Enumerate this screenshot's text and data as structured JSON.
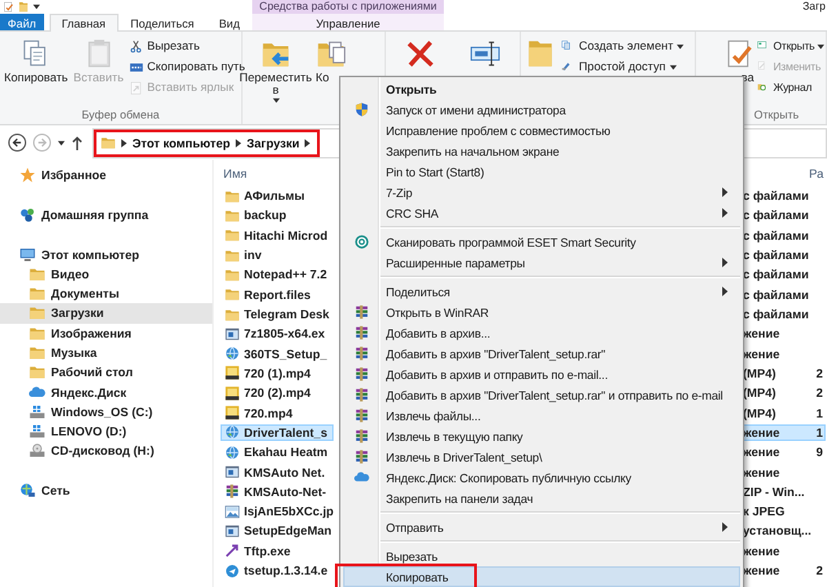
{
  "window": {
    "title": "Загр",
    "context_header": "Средства работы с приложениями"
  },
  "tabs": [
    {
      "label": "Файл",
      "kind": "file",
      "selected": false
    },
    {
      "label": "Главная",
      "kind": "tab",
      "selected": true
    },
    {
      "label": "Поделиться",
      "kind": "tab",
      "selected": false
    },
    {
      "label": "Вид",
      "kind": "tab",
      "selected": false
    },
    {
      "label": "Управление",
      "kind": "context",
      "selected": false
    }
  ],
  "ribbon": {
    "groups": [
      {
        "label": "Буфер обмена",
        "large": [
          {
            "kind": "copy",
            "label": "Копировать",
            "disabled": false,
            "dropdown": false
          },
          {
            "kind": "paste",
            "label": "Вставить",
            "disabled": true,
            "dropdown": false
          }
        ],
        "small": [
          {
            "kind": "cut",
            "label": "Вырезать",
            "disabled": false,
            "dropdown": false
          },
          {
            "kind": "copypath",
            "label": "Скопировать путь",
            "disabled": false,
            "dropdown": false
          },
          {
            "kind": "shortcut",
            "label": "Вставить ярлык",
            "disabled": true,
            "dropdown": false
          }
        ]
      },
      {
        "large": [
          {
            "kind": "move",
            "label": "Переместить в",
            "disabled": false,
            "dropdown": true
          },
          {
            "kind": "copyto",
            "label": "Ко",
            "disabled": false,
            "dropdown": false
          }
        ]
      },
      {
        "large": [
          {
            "kind": "delete",
            "disabled": false,
            "dropdown": false
          },
          {
            "kind": "rename",
            "disabled": false,
            "dropdown": false
          }
        ]
      },
      {
        "large": [
          {
            "kind": "newfolder",
            "disabled": false,
            "dropdown": false
          }
        ],
        "small": [
          {
            "kind": "newitem",
            "label": "Создать элемент",
            "disabled": false,
            "dropdown": true
          },
          {
            "kind": "easyaccess",
            "label": "Простой доступ",
            "disabled": false,
            "dropdown": true
          }
        ]
      },
      {
        "label": "Открыть",
        "large": [
          {
            "kind": "properties",
            "label": "ва",
            "disabled": false,
            "dropdown": false
          }
        ],
        "small": [
          {
            "kind": "open",
            "label": "Открыть",
            "disabled": false,
            "dropdown": true
          },
          {
            "kind": "edit",
            "label": "Изменить",
            "disabled": true,
            "dropdown": false
          },
          {
            "kind": "history",
            "label": "Журнал",
            "disabled": false,
            "dropdown": false
          }
        ]
      }
    ]
  },
  "navigation": {
    "back_enabled": true,
    "forward_enabled": false,
    "breadcrumb": {
      "segments": [
        "Этот компьютер",
        "Загрузки"
      ],
      "annotated": true
    }
  },
  "sidebar": {
    "items": [
      {
        "label": "Избранное",
        "kind": "star",
        "selected": false
      },
      {
        "label": "Домашняя группа",
        "kind": "homegroup",
        "selected": false
      },
      {
        "label": "Этот компьютер",
        "kind": "computer",
        "selected": false,
        "children": [
          {
            "label": "Видео",
            "kind": "folder",
            "selected": false
          },
          {
            "label": "Документы",
            "kind": "folder",
            "selected": false
          },
          {
            "label": "Загрузки",
            "kind": "folder",
            "selected": true
          },
          {
            "label": "Изображения",
            "kind": "folder",
            "selected": false
          },
          {
            "label": "Музыка",
            "kind": "folder",
            "selected": false
          },
          {
            "label": "Рабочий стол",
            "kind": "folder",
            "selected": false
          },
          {
            "label": "Яндекс.Диск",
            "kind": "cloud",
            "selected": false
          },
          {
            "label": "Windows_OS (C:)",
            "kind": "drive",
            "selected": false
          },
          {
            "label": "LENOVO (D:)",
            "kind": "drive",
            "selected": false
          },
          {
            "label": "CD-дисковод (H:)",
            "kind": "disc",
            "selected": false
          }
        ]
      },
      {
        "label": "Сеть",
        "kind": "network",
        "selected": false
      }
    ]
  },
  "files": {
    "columns": [
      "Имя",
      "Ра"
    ],
    "rows": [
      {
        "name": "АФильмы",
        "kind": "folder",
        "type": "с файлами",
        "selected": false
      },
      {
        "name": "backup",
        "kind": "folder",
        "type": "с файлами",
        "selected": false
      },
      {
        "name": "Hitachi Microd",
        "kind": "folder",
        "type": "с файлами",
        "selected": false
      },
      {
        "name": "inv",
        "kind": "folder",
        "type": "с файлами",
        "selected": false
      },
      {
        "name": "Notepad++ 7.2",
        "kind": "folder",
        "type": "с файлами",
        "selected": false
      },
      {
        "name": "Report.files",
        "kind": "folder",
        "type": "с файлами",
        "selected": false
      },
      {
        "name": "Telegram Desk",
        "kind": "folder",
        "type": "с файлами",
        "selected": false
      },
      {
        "name": "7z1805-x64.ex",
        "kind": "app",
        "type": "жение",
        "selected": false
      },
      {
        "name": "360TS_Setup_",
        "kind": "globe",
        "type": "жение",
        "selected": false
      },
      {
        "name": "720 (1).mp4",
        "kind": "video",
        "type": "(MP4)",
        "size": "2",
        "selected": false
      },
      {
        "name": "720 (2).mp4",
        "kind": "video",
        "type": "(MP4)",
        "size": "2",
        "selected": false
      },
      {
        "name": "720.mp4",
        "kind": "video",
        "type": "(MP4)",
        "size": "1",
        "selected": false
      },
      {
        "name": "DriverTalent_s",
        "kind": "globe",
        "type": "жение",
        "size": "1",
        "selected": true
      },
      {
        "name": "Ekahau Heatm",
        "kind": "globe",
        "type": "жение",
        "size": "9",
        "selected": false
      },
      {
        "name": "KMSAuto Net.",
        "kind": "app",
        "type": "жение",
        "selected": false
      },
      {
        "name": "KMSAuto-Net-",
        "kind": "archive",
        "type": "ZIP - Win...",
        "selected": false
      },
      {
        "name": "IsjAnE5bXCc.jp",
        "kind": "image",
        "type": "к JPEG",
        "selected": false
      },
      {
        "name": "SetupEdgeMan",
        "kind": "app",
        "type": "установщ...",
        "selected": false
      },
      {
        "name": "Tftp.exe",
        "kind": "shortcut",
        "type": "жение",
        "selected": false
      },
      {
        "name": "tsetup.1.3.14.e",
        "kind": "circle",
        "type": "жение",
        "size": "2",
        "selected": false
      }
    ]
  },
  "context_menu": {
    "items": [
      {
        "kind": "default",
        "label": "Открыть",
        "submenu": false,
        "selected": false,
        "annotated": false
      },
      {
        "kind": "admin",
        "label": "Запуск от имени администратора",
        "submenu": false,
        "selected": false,
        "annotated": false
      },
      {
        "kind": "plain",
        "label": "Исправление проблем с совместимостью",
        "submenu": false,
        "selected": false,
        "annotated": false
      },
      {
        "kind": "plain",
        "label": "Закрепить на начальном экране",
        "submenu": false,
        "selected": false,
        "annotated": false
      },
      {
        "kind": "plain",
        "label": "Pin to Start (Start8)",
        "submenu": false,
        "selected": false,
        "annotated": false
      },
      {
        "kind": "plain",
        "label": "7-Zip",
        "submenu": true,
        "selected": false,
        "annotated": false
      },
      {
        "kind": "plain",
        "label": "CRC SHA",
        "submenu": true,
        "selected": false,
        "annotated": false
      },
      {
        "kind": "separator"
      },
      {
        "kind": "antivirus",
        "label": "Сканировать программой ESET Smart Security",
        "submenu": false,
        "selected": false,
        "annotated": false
      },
      {
        "kind": "plain",
        "label": "Расширенные параметры",
        "submenu": true,
        "selected": false,
        "annotated": false
      },
      {
        "kind": "separator"
      },
      {
        "kind": "plain",
        "label": "Поделиться",
        "submenu": true,
        "selected": false,
        "annotated": false
      },
      {
        "kind": "archive",
        "label": "Открыть в WinRAR",
        "submenu": false,
        "selected": false,
        "annotated": false
      },
      {
        "kind": "archive",
        "label": "Добавить в архив...",
        "submenu": false,
        "selected": false,
        "annotated": false
      },
      {
        "kind": "archive",
        "label": "Добавить в архив \"DriverTalent_setup.rar\"",
        "submenu": false,
        "selected": false,
        "annotated": false
      },
      {
        "kind": "archive",
        "label": "Добавить в архив и отправить по e-mail...",
        "submenu": false,
        "selected": false,
        "annotated": false
      },
      {
        "kind": "archive",
        "label": "Добавить в архив \"DriverTalent_setup.rar\" и отправить по e-mail",
        "submenu": false,
        "selected": false,
        "annotated": false
      },
      {
        "kind": "archive",
        "label": "Извлечь файлы...",
        "submenu": false,
        "selected": false,
        "annotated": false
      },
      {
        "kind": "archive",
        "label": "Извлечь в текущую папку",
        "submenu": false,
        "selected": false,
        "annotated": false
      },
      {
        "kind": "archive",
        "label": "Извлечь в DriverTalent_setup\\",
        "submenu": false,
        "selected": false,
        "annotated": false
      },
      {
        "kind": "cloud",
        "label": "Яндекс.Диск: Скопировать публичную ссылку",
        "submenu": false,
        "selected": false,
        "annotated": false
      },
      {
        "kind": "plain",
        "label": "Закрепить на панели задач",
        "submenu": false,
        "selected": false,
        "annotated": false
      },
      {
        "kind": "separator"
      },
      {
        "kind": "plain",
        "label": "Отправить",
        "submenu": true,
        "selected": false,
        "annotated": false
      },
      {
        "kind": "separator"
      },
      {
        "kind": "plain",
        "label": "Вырезать",
        "submenu": false,
        "selected": false,
        "annotated": false
      },
      {
        "kind": "plain",
        "label": "Копировать",
        "submenu": false,
        "selected": true,
        "annotated": true
      }
    ]
  }
}
